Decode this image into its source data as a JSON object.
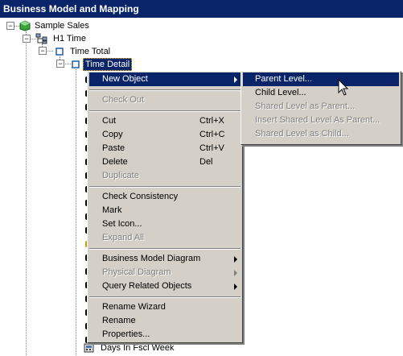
{
  "window": {
    "title": "Business Model and Mapping"
  },
  "tree": {
    "root": "Sample Sales",
    "dimension": "H1 Time",
    "total": "Time Total",
    "detail": "Time Detail",
    "last_item": "Days In Fscl Week"
  },
  "context_menu": {
    "items": [
      {
        "label": "New Object",
        "shortcut": ""
      },
      {
        "label": "Check Out",
        "shortcut": ""
      },
      {
        "label": "Cut",
        "shortcut": "Ctrl+X"
      },
      {
        "label": "Copy",
        "shortcut": "Ctrl+C"
      },
      {
        "label": "Paste",
        "shortcut": "Ctrl+V"
      },
      {
        "label": "Delete",
        "shortcut": "Del"
      },
      {
        "label": "Duplicate",
        "shortcut": ""
      },
      {
        "label": "Check Consistency",
        "shortcut": ""
      },
      {
        "label": "Mark",
        "shortcut": ""
      },
      {
        "label": "Set Icon...",
        "shortcut": ""
      },
      {
        "label": "Expand All",
        "shortcut": ""
      },
      {
        "label": "Business Model Diagram",
        "shortcut": ""
      },
      {
        "label": "Physical Diagram",
        "shortcut": ""
      },
      {
        "label": "Query Related Objects",
        "shortcut": ""
      },
      {
        "label": "Rename Wizard",
        "shortcut": ""
      },
      {
        "label": "Rename",
        "shortcut": ""
      },
      {
        "label": "Properties...",
        "shortcut": ""
      }
    ]
  },
  "submenu": {
    "items": [
      {
        "label": "Parent Level..."
      },
      {
        "label": "Child Level..."
      },
      {
        "label": "Shared Level as Parent..."
      },
      {
        "label": "Insert Shared Level As Parent..."
      },
      {
        "label": "Shared Level as Child..."
      }
    ]
  },
  "colors": {
    "highlight": "#0a246a",
    "menu_bg": "#d4d0c8",
    "disabled": "#808080"
  }
}
